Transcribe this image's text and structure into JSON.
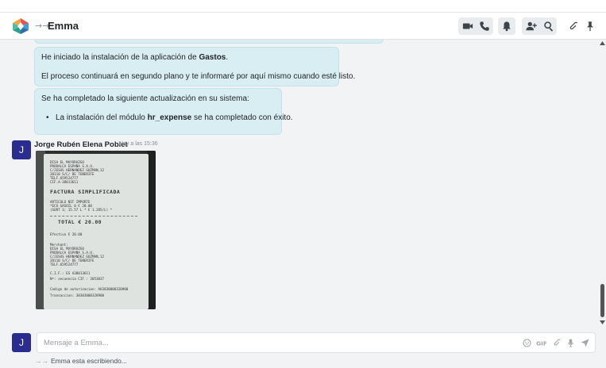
{
  "header": {
    "title": "Emma",
    "bot_glyph": "→→"
  },
  "messages": {
    "bot1": {
      "line1_pre": "He iniciado la instalación de la aplicación de ",
      "line1_bold": "Gastos",
      "line1_post": ".",
      "line2": "El proceso continuará en segundo plano y te informaré por aquí mismo cuando esté listo."
    },
    "bot2": {
      "line1": "Se ha completado la siguiente actualización en su sistema:",
      "bullet_pre": "La instalación del módulo ",
      "bullet_bold": "hr_expense",
      "bullet_post": " se ha completado con éxito."
    },
    "user": {
      "avatar_letter": "J",
      "author": "Jorge Rubén Elena Poblet",
      "timestamp": "Hoy a las 15:36"
    }
  },
  "receipt_lines": [
    "DISA EL MAYORAZGO",
    "PRODALCA ESPAÑA S.A.U.",
    "C/JESUS HERNANDEZ GUZMAN,12",
    "38110 S/C/ DE TENERIFE",
    "TELF.659524777",
    "CIF.A-38013611",
    "FACTURA SIMPLIFICADA",
    "ARTICULO        NIF     IMPORTE",
    "*ECO GASOIL       0     € 20.00",
    "(SURT 3; 15.57 L * € 1.285/L) *",
    "TOTAL               € 20.00",
    "Efectivo                € 20.00",
    "Merchant:",
    "DISA EL MAYORAZGO",
    "PRODALCA ESPAÑA S.A.U.",
    "C/JESUS HERNANDEZ GUZMAN,12",
    "38110 S/C/ DE TENERIFE",
    "TELF.659524777",
    "C.I.F.:           ES A38013611",
    "Nº: secuencia CIF :    3053037",
    "Codigo de autorizacion: AU3030000320900",
    "Transaccion:       30303000328900"
  ],
  "composer": {
    "avatar_letter": "J",
    "placeholder": "Mensaje a Emma...",
    "value": ""
  },
  "typing": {
    "glyph": "→→",
    "text": "Emma esta escribiendo..."
  },
  "colors": {
    "bot_bubble": "#d9eef2",
    "avatar": "#2a2d8f",
    "background": "#f1f3f4"
  },
  "icons": [
    "video-icon",
    "phone-icon",
    "bell-icon",
    "add-user-icon",
    "search-icon",
    "paperclip-icon",
    "pin-icon",
    "emoji-icon",
    "gif-icon",
    "attach-icon",
    "microphone-icon",
    "send-icon"
  ]
}
